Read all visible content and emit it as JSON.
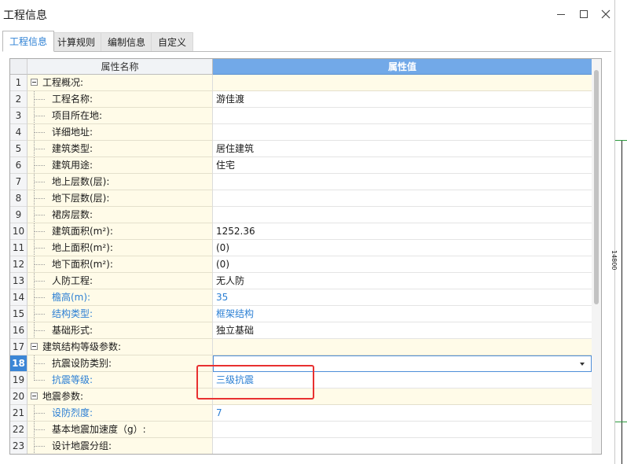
{
  "window": {
    "title": "工程信息"
  },
  "tabs": [
    {
      "label": "工程信息",
      "active": true
    },
    {
      "label": "计算规则",
      "active": false
    },
    {
      "label": "编制信息",
      "active": false
    },
    {
      "label": "自定义",
      "active": false
    }
  ],
  "grid": {
    "headers": {
      "name": "属性名称",
      "value": "属性值"
    },
    "rows": [
      {
        "num": "1",
        "name": "工程概况:",
        "value": "",
        "group": true
      },
      {
        "num": "2",
        "name": "工程名称:",
        "value": "游佳渡"
      },
      {
        "num": "3",
        "name": "项目所在地:",
        "value": ""
      },
      {
        "num": "4",
        "name": "详细地址:",
        "value": ""
      },
      {
        "num": "5",
        "name": "建筑类型:",
        "value": "居住建筑"
      },
      {
        "num": "6",
        "name": "建筑用途:",
        "value": "住宅"
      },
      {
        "num": "7",
        "name": "地上层数(层):",
        "value": ""
      },
      {
        "num": "8",
        "name": "地下层数(层):",
        "value": ""
      },
      {
        "num": "9",
        "name": "裙房层数:",
        "value": ""
      },
      {
        "num": "10",
        "name": "建筑面积(m²):",
        "value": "1252.36"
      },
      {
        "num": "11",
        "name": "地上面积(m²):",
        "value": "(0)"
      },
      {
        "num": "12",
        "name": "地下面积(m²):",
        "value": "(0)"
      },
      {
        "num": "13",
        "name": "人防工程:",
        "value": "无人防"
      },
      {
        "num": "14",
        "name": "檐高(m):",
        "value": "35",
        "blue": true
      },
      {
        "num": "15",
        "name": "结构类型:",
        "value": "框架结构",
        "blue": true
      },
      {
        "num": "16",
        "name": "基础形式:",
        "value": "独立基础"
      },
      {
        "num": "17",
        "name": "建筑结构等级参数:",
        "value": "",
        "group": true
      },
      {
        "num": "18",
        "name": "抗震设防类别:",
        "value": "",
        "selected": true
      },
      {
        "num": "19",
        "name": "抗震等级:",
        "value": "三级抗震",
        "blue": true,
        "last": true
      },
      {
        "num": "20",
        "name": "地震参数:",
        "value": "",
        "group": true
      },
      {
        "num": "21",
        "name": "设防烈度:",
        "value": "7",
        "blue": true
      },
      {
        "num": "22",
        "name": "基本地震加速度（g）:",
        "value": ""
      },
      {
        "num": "23",
        "name": "设计地震分组:",
        "value": ""
      }
    ]
  },
  "side_label": "14800",
  "accent_colors": {
    "header_blue": "#72a9e8",
    "text_blue": "#2b7fd4",
    "highlight_red": "#e83030",
    "name_bg": "#fffbe8"
  },
  "icons": [
    "minimize-icon",
    "maximize-icon",
    "close-icon",
    "collapse-icon",
    "dropdown-arrow-icon"
  ]
}
